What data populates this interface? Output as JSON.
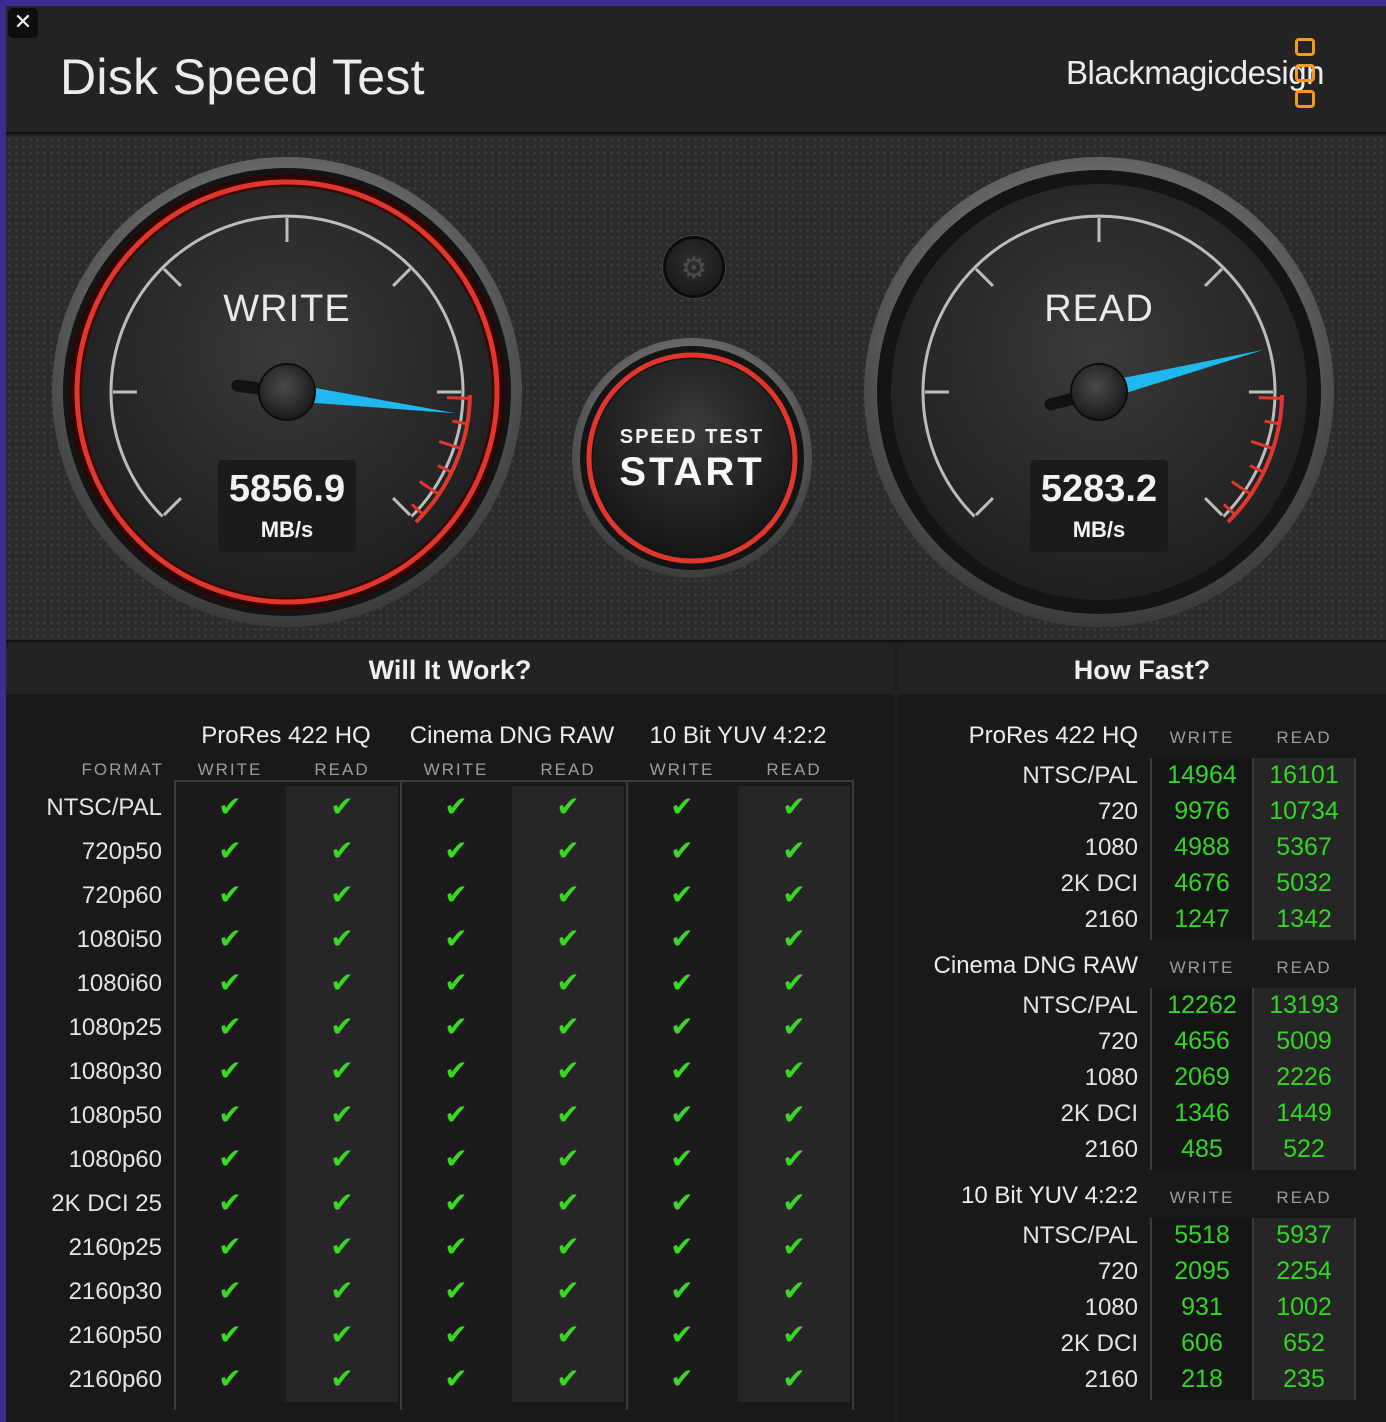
{
  "app": {
    "title": "Disk Speed Test",
    "brand": "Blackmagicdesign",
    "close_icon": "✕",
    "settings_icon": "⚙"
  },
  "write_gauge": {
    "label": "WRITE",
    "value": "5856.9",
    "unit": "MB/s",
    "needle_fraction": 0.86
  },
  "read_gauge": {
    "label": "READ",
    "value": "5283.2",
    "unit": "MB/s",
    "needle_fraction": 0.78
  },
  "start_button": {
    "top_label": "SPEED TEST",
    "main_label": "START"
  },
  "will_it_work": {
    "title": "Will It Work?",
    "format_header": "FORMAT",
    "codecs": [
      "ProRes 422 HQ",
      "Cinema DNG RAW",
      "10 Bit YUV 4:2:2"
    ],
    "write_label": "WRITE",
    "read_label": "READ",
    "check_mark": "✔",
    "formats": [
      "NTSC/PAL",
      "720p50",
      "720p60",
      "1080i50",
      "1080i60",
      "1080p25",
      "1080p30",
      "1080p50",
      "1080p60",
      "2K DCI 25",
      "2160p25",
      "2160p30",
      "2160p50",
      "2160p60"
    ],
    "results": "all-pass"
  },
  "how_fast": {
    "title": "How Fast?",
    "write_label": "WRITE",
    "read_label": "READ",
    "sections": [
      {
        "codec": "ProRes 422 HQ",
        "rows": [
          {
            "format": "NTSC/PAL",
            "write": "14964",
            "read": "16101"
          },
          {
            "format": "720",
            "write": "9976",
            "read": "10734"
          },
          {
            "format": "1080",
            "write": "4988",
            "read": "5367"
          },
          {
            "format": "2K DCI",
            "write": "4676",
            "read": "5032"
          },
          {
            "format": "2160",
            "write": "1247",
            "read": "1342"
          }
        ]
      },
      {
        "codec": "Cinema DNG RAW",
        "rows": [
          {
            "format": "NTSC/PAL",
            "write": "12262",
            "read": "13193"
          },
          {
            "format": "720",
            "write": "4656",
            "read": "5009"
          },
          {
            "format": "1080",
            "write": "2069",
            "read": "2226"
          },
          {
            "format": "2K DCI",
            "write": "1346",
            "read": "1449"
          },
          {
            "format": "2160",
            "write": "485",
            "read": "522"
          }
        ]
      },
      {
        "codec": "10 Bit YUV 4:2:2",
        "rows": [
          {
            "format": "NTSC/PAL",
            "write": "5518",
            "read": "5937"
          },
          {
            "format": "720",
            "write": "2095",
            "read": "2254"
          },
          {
            "format": "1080",
            "write": "931",
            "read": "1002"
          },
          {
            "format": "2K DCI",
            "write": "606",
            "read": "652"
          },
          {
            "format": "2160",
            "write": "218",
            "read": "235"
          }
        ]
      }
    ]
  },
  "colors": {
    "accent_red": "#e0362c",
    "needle_blue": "#1fb9f0",
    "check_green": "#39d623",
    "value_green": "#33d523",
    "logo_orange": "#f39a1f"
  }
}
